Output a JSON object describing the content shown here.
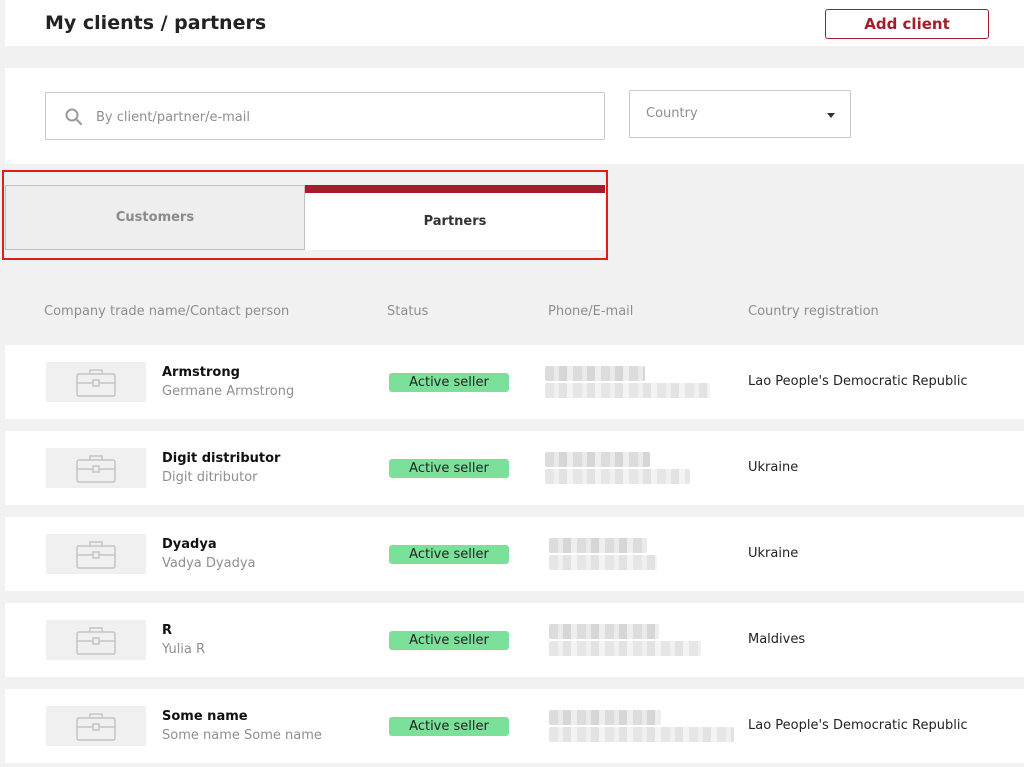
{
  "header": {
    "title": "My clients / partners",
    "add_button": "Add client"
  },
  "filters": {
    "search_placeholder": "By client/partner/e-mail",
    "search_value": "",
    "country_label": "Country"
  },
  "tabs": [
    {
      "label": "Customers",
      "active": false
    },
    {
      "label": "Partners",
      "active": true
    }
  ],
  "table": {
    "columns": [
      "Company trade name/Contact person",
      "Status",
      "Phone/E-mail",
      "Country registration"
    ],
    "rows": [
      {
        "company": "Armstrong",
        "contact": "Germane Armstrong",
        "status": "Active seller",
        "country": "Lao People's Democratic Republic"
      },
      {
        "company": "Digit distributor",
        "contact": "Digit ditributor",
        "status": "Active seller",
        "country": "Ukraine"
      },
      {
        "company": "Dyadya",
        "contact": "Vadya Dyadya",
        "status": "Active seller",
        "country": "Ukraine"
      },
      {
        "company": "R",
        "contact": "Yulia R",
        "status": "Active seller",
        "country": "Maldives"
      },
      {
        "company": "Some name",
        "contact": "Some name Some name",
        "status": "Active seller",
        "country": "Lao People's Democratic Republic"
      }
    ]
  },
  "icons": {
    "search": "search-icon",
    "dropdown": "chevron-down-icon",
    "company_logo": "briefcase-icon"
  },
  "colors": {
    "accent": "#a51c2a",
    "status_active": "#7be19a",
    "highlight": "#e31b1b"
  }
}
